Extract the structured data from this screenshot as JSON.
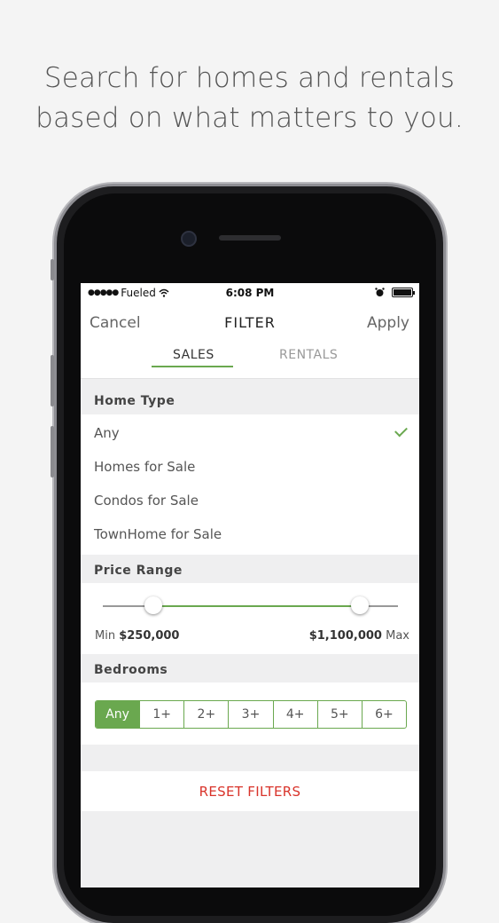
{
  "headline": {
    "line1": "Search for homes and rentals",
    "line2": "based on what matters to you."
  },
  "status_bar": {
    "carrier": "Fueled",
    "time": "6:08 PM"
  },
  "nav": {
    "cancel": "Cancel",
    "title": "FILTER",
    "apply": "Apply"
  },
  "tabs": [
    {
      "label": "SALES",
      "active": true
    },
    {
      "label": "RENTALS",
      "active": false
    }
  ],
  "home_type": {
    "header": "Home Type",
    "options": [
      "Any",
      "Homes for Sale",
      "Condos for Sale",
      "TownHome for Sale"
    ],
    "selected": "Any"
  },
  "price_range": {
    "header": "Price Range",
    "min_label": "Min",
    "min_value": "$250,000",
    "max_label": "Max",
    "max_value": "$1,100,000",
    "min_fraction": 0.17,
    "max_fraction": 0.87
  },
  "bedrooms": {
    "header": "Bedrooms",
    "options": [
      "Any",
      "1+",
      "2+",
      "3+",
      "4+",
      "5+",
      "6+"
    ],
    "selected": "Any"
  },
  "reset": "RESET FILTERS",
  "colors": {
    "accent": "#6aa84f",
    "reset": "#d9342b"
  }
}
